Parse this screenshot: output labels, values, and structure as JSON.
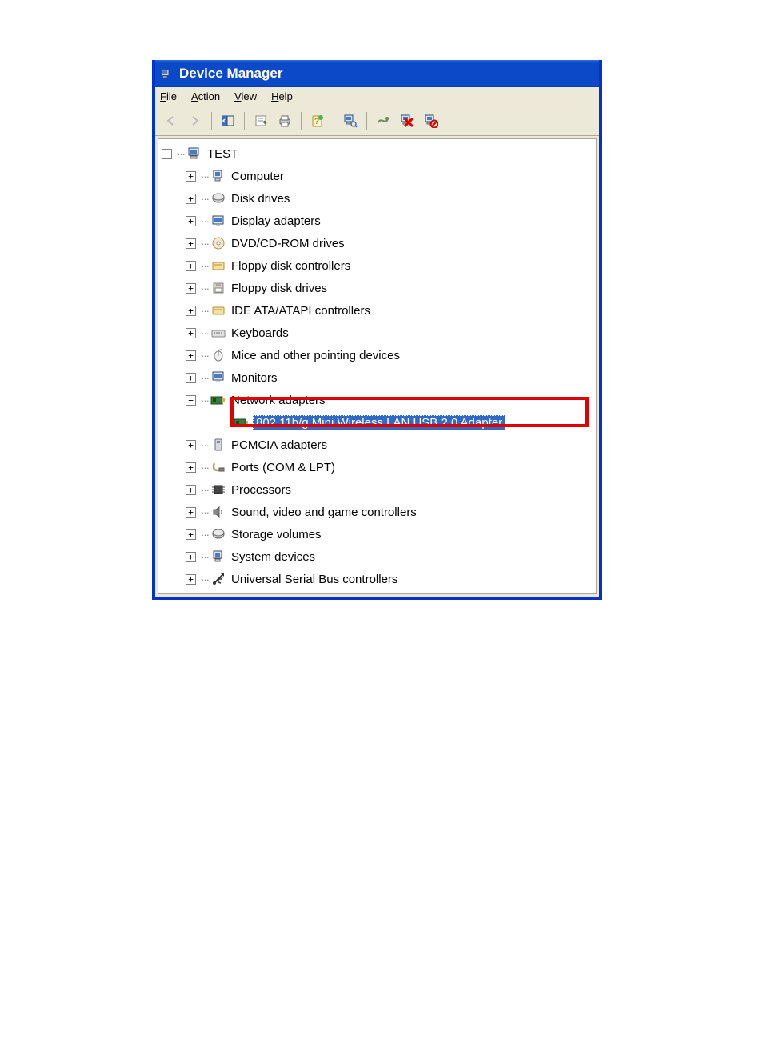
{
  "window": {
    "title": "Device Manager"
  },
  "menu": {
    "file": "File",
    "action": "Action",
    "view": "View",
    "help": "Help"
  },
  "tree": {
    "root": "TEST",
    "nodes": {
      "computer": "Computer",
      "disk_drives": "Disk drives",
      "display_adapters": "Display adapters",
      "dvd_cd_rom": "DVD/CD-ROM drives",
      "floppy_controllers": "Floppy disk controllers",
      "floppy_drives": "Floppy disk drives",
      "ide": "IDE ATA/ATAPI controllers",
      "keyboards": "Keyboards",
      "mice": "Mice and other pointing devices",
      "monitors": "Monitors",
      "network_adapters": "Network adapters",
      "wireless_adapter": "802.11b/g Mini Wireless LAN USB 2.0 Adapter",
      "pcmcia": "PCMCIA adapters",
      "ports": "Ports (COM & LPT)",
      "processors": "Processors",
      "sound": "Sound, video and game controllers",
      "storage": "Storage volumes",
      "system": "System devices",
      "usb": "Universal Serial Bus controllers"
    }
  }
}
